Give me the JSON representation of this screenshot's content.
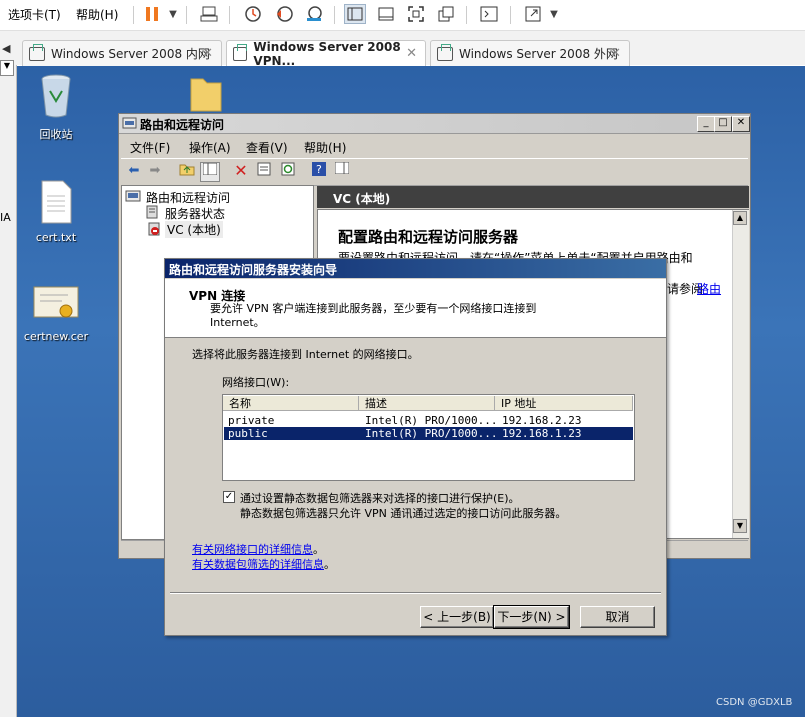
{
  "vmware": {
    "menu": [
      "选项卡(T)",
      "帮助(H)"
    ],
    "tabs": [
      {
        "label": "Windows Server 2008 内网",
        "active": false
      },
      {
        "label": "Windows Server 2008 VPN...",
        "active": true
      },
      {
        "label": "Windows Server 2008 外网",
        "active": false
      }
    ],
    "left_sliver_text": "IA"
  },
  "desktop": {
    "icons": [
      {
        "name": "recycle-bin",
        "label": "回收站"
      },
      {
        "name": "text-file",
        "label": "cert.txt"
      },
      {
        "name": "certificate",
        "label": "certnew.cer"
      }
    ]
  },
  "rras": {
    "title": "路由和远程访问",
    "menu": [
      "文件(F)",
      "操作(A)",
      "查看(V)",
      "帮助(H)"
    ],
    "tree": {
      "root": "路由和远程访问",
      "children": [
        "服务器状态",
        "VC (本地)"
      ]
    },
    "right_header": "VC (本地)",
    "content_title": "配置路由和远程访问服务器",
    "content_text1": "要设置路由和远程访问，请在“操作”菜单上单击“配置并启用路由和",
    "content_text2": "请参阅",
    "content_link": "路由"
  },
  "wizard": {
    "title": "路由和远程访问服务器安装向导",
    "heading": "VPN 连接",
    "description": "要允许 VPN 客户端连接到此服务器，至少要有一个网络接口连接到 Internet。",
    "prompt": "选择将此服务器连接到 Internet 的网络接口。",
    "list_label": "网络接口(W):",
    "columns": [
      "名称",
      "描述",
      "IP 地址"
    ],
    "rows": [
      {
        "name": "private",
        "desc": "Intel(R) PRO/1000...",
        "ip": "192.168.2.23",
        "selected": false
      },
      {
        "name": "public",
        "desc": "Intel(R) PRO/1000...",
        "ip": "192.168.1.23",
        "selected": true
      }
    ],
    "checkbox_label": "通过设置静态数据包筛选器来对选择的接口进行保护(E)。",
    "checkbox_checked": true,
    "checkbox_note": "静态数据包筛选器只允许 VPN 通讯通过选定的接口访问此服务器。",
    "link1": "有关网络接口的详细信息",
    "link2": "有关数据包筛选的详细信息",
    "link_suffix": "。",
    "back_button": "< 上一步(B)",
    "next_button": "下一步(N) >",
    "cancel_button": "取消"
  },
  "watermark": "CSDN @GDXLB"
}
